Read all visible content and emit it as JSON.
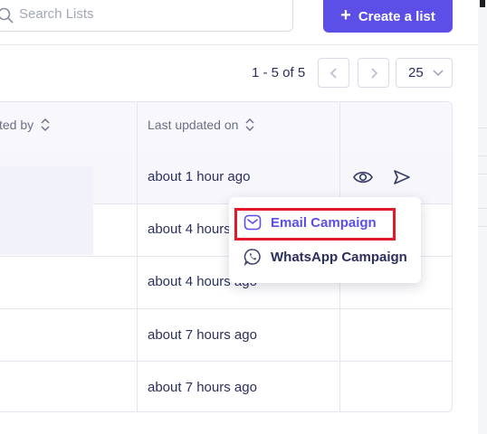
{
  "search": {
    "placeholder": "Search Lists"
  },
  "toolbar": {
    "create_label": "Create a list"
  },
  "pagination": {
    "range_text": "1 - 5 of 5",
    "per_page": "25"
  },
  "table": {
    "columns": {
      "created_by": "ted by",
      "last_updated": "Last updated on"
    },
    "rows": [
      {
        "last_updated": "about 1 hour ago"
      },
      {
        "last_updated": "about 4 hours ago"
      },
      {
        "last_updated": "about 4 hours ago"
      },
      {
        "last_updated": "about 7 hours ago"
      },
      {
        "last_updated": "about 7 hours ago"
      }
    ]
  },
  "campaign_menu": {
    "items": [
      {
        "label": "Email Campaign",
        "icon": "mail-icon"
      },
      {
        "label": "WhatsApp Campaign",
        "icon": "whatsapp-icon"
      }
    ]
  },
  "colors": {
    "accent": "#5b4fe8",
    "highlight": "#e01a2b",
    "text": "#2a2f5b"
  }
}
